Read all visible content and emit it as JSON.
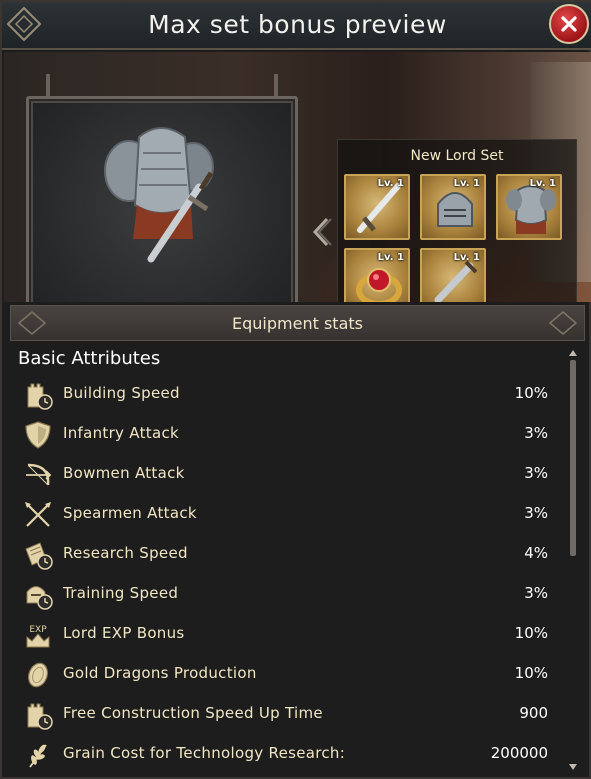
{
  "header": {
    "title": "Max set bonus preview"
  },
  "set": {
    "title": "New Lord Set",
    "items": [
      {
        "icon": "sword-icon",
        "level": "Lv. 1"
      },
      {
        "icon": "helmet-icon",
        "level": "Lv. 1"
      },
      {
        "icon": "armor-icon",
        "level": "Lv. 1"
      },
      {
        "icon": "ring-icon",
        "level": "Lv. 1"
      },
      {
        "icon": "dagger-icon",
        "level": "Lv. 1"
      }
    ]
  },
  "stats": {
    "header": "Equipment stats",
    "section_title": "Basic Attributes",
    "rows": [
      {
        "icon": "tower-clock-icon",
        "label": "Building Speed",
        "value": "10%"
      },
      {
        "icon": "shield-icon",
        "label": "Infantry Attack",
        "value": "3%"
      },
      {
        "icon": "bow-icon",
        "label": "Bowmen Attack",
        "value": "3%"
      },
      {
        "icon": "crossed-spears-icon",
        "label": "Spearmen Attack",
        "value": "3%"
      },
      {
        "icon": "book-clock-icon",
        "label": "Research Speed",
        "value": "4%"
      },
      {
        "icon": "helmet-clock-icon",
        "label": "Training Speed",
        "value": "3%"
      },
      {
        "icon": "exp-crown-icon",
        "icon_text": "EXP",
        "label": "Lord EXP Bonus",
        "value": "10%"
      },
      {
        "icon": "gold-coin-icon",
        "label": "Gold Dragons Production",
        "value": "10%"
      },
      {
        "icon": "tower-clock-icon",
        "label": "Free Construction Speed Up Time",
        "value": "900"
      },
      {
        "icon": "grain-icon",
        "label": "Grain Cost for Technology Research:",
        "value": "200000"
      }
    ]
  },
  "colors": {
    "accent_gold": "#c9a456",
    "close_red": "#c3262a",
    "label_cream": "#f1e6c3"
  }
}
